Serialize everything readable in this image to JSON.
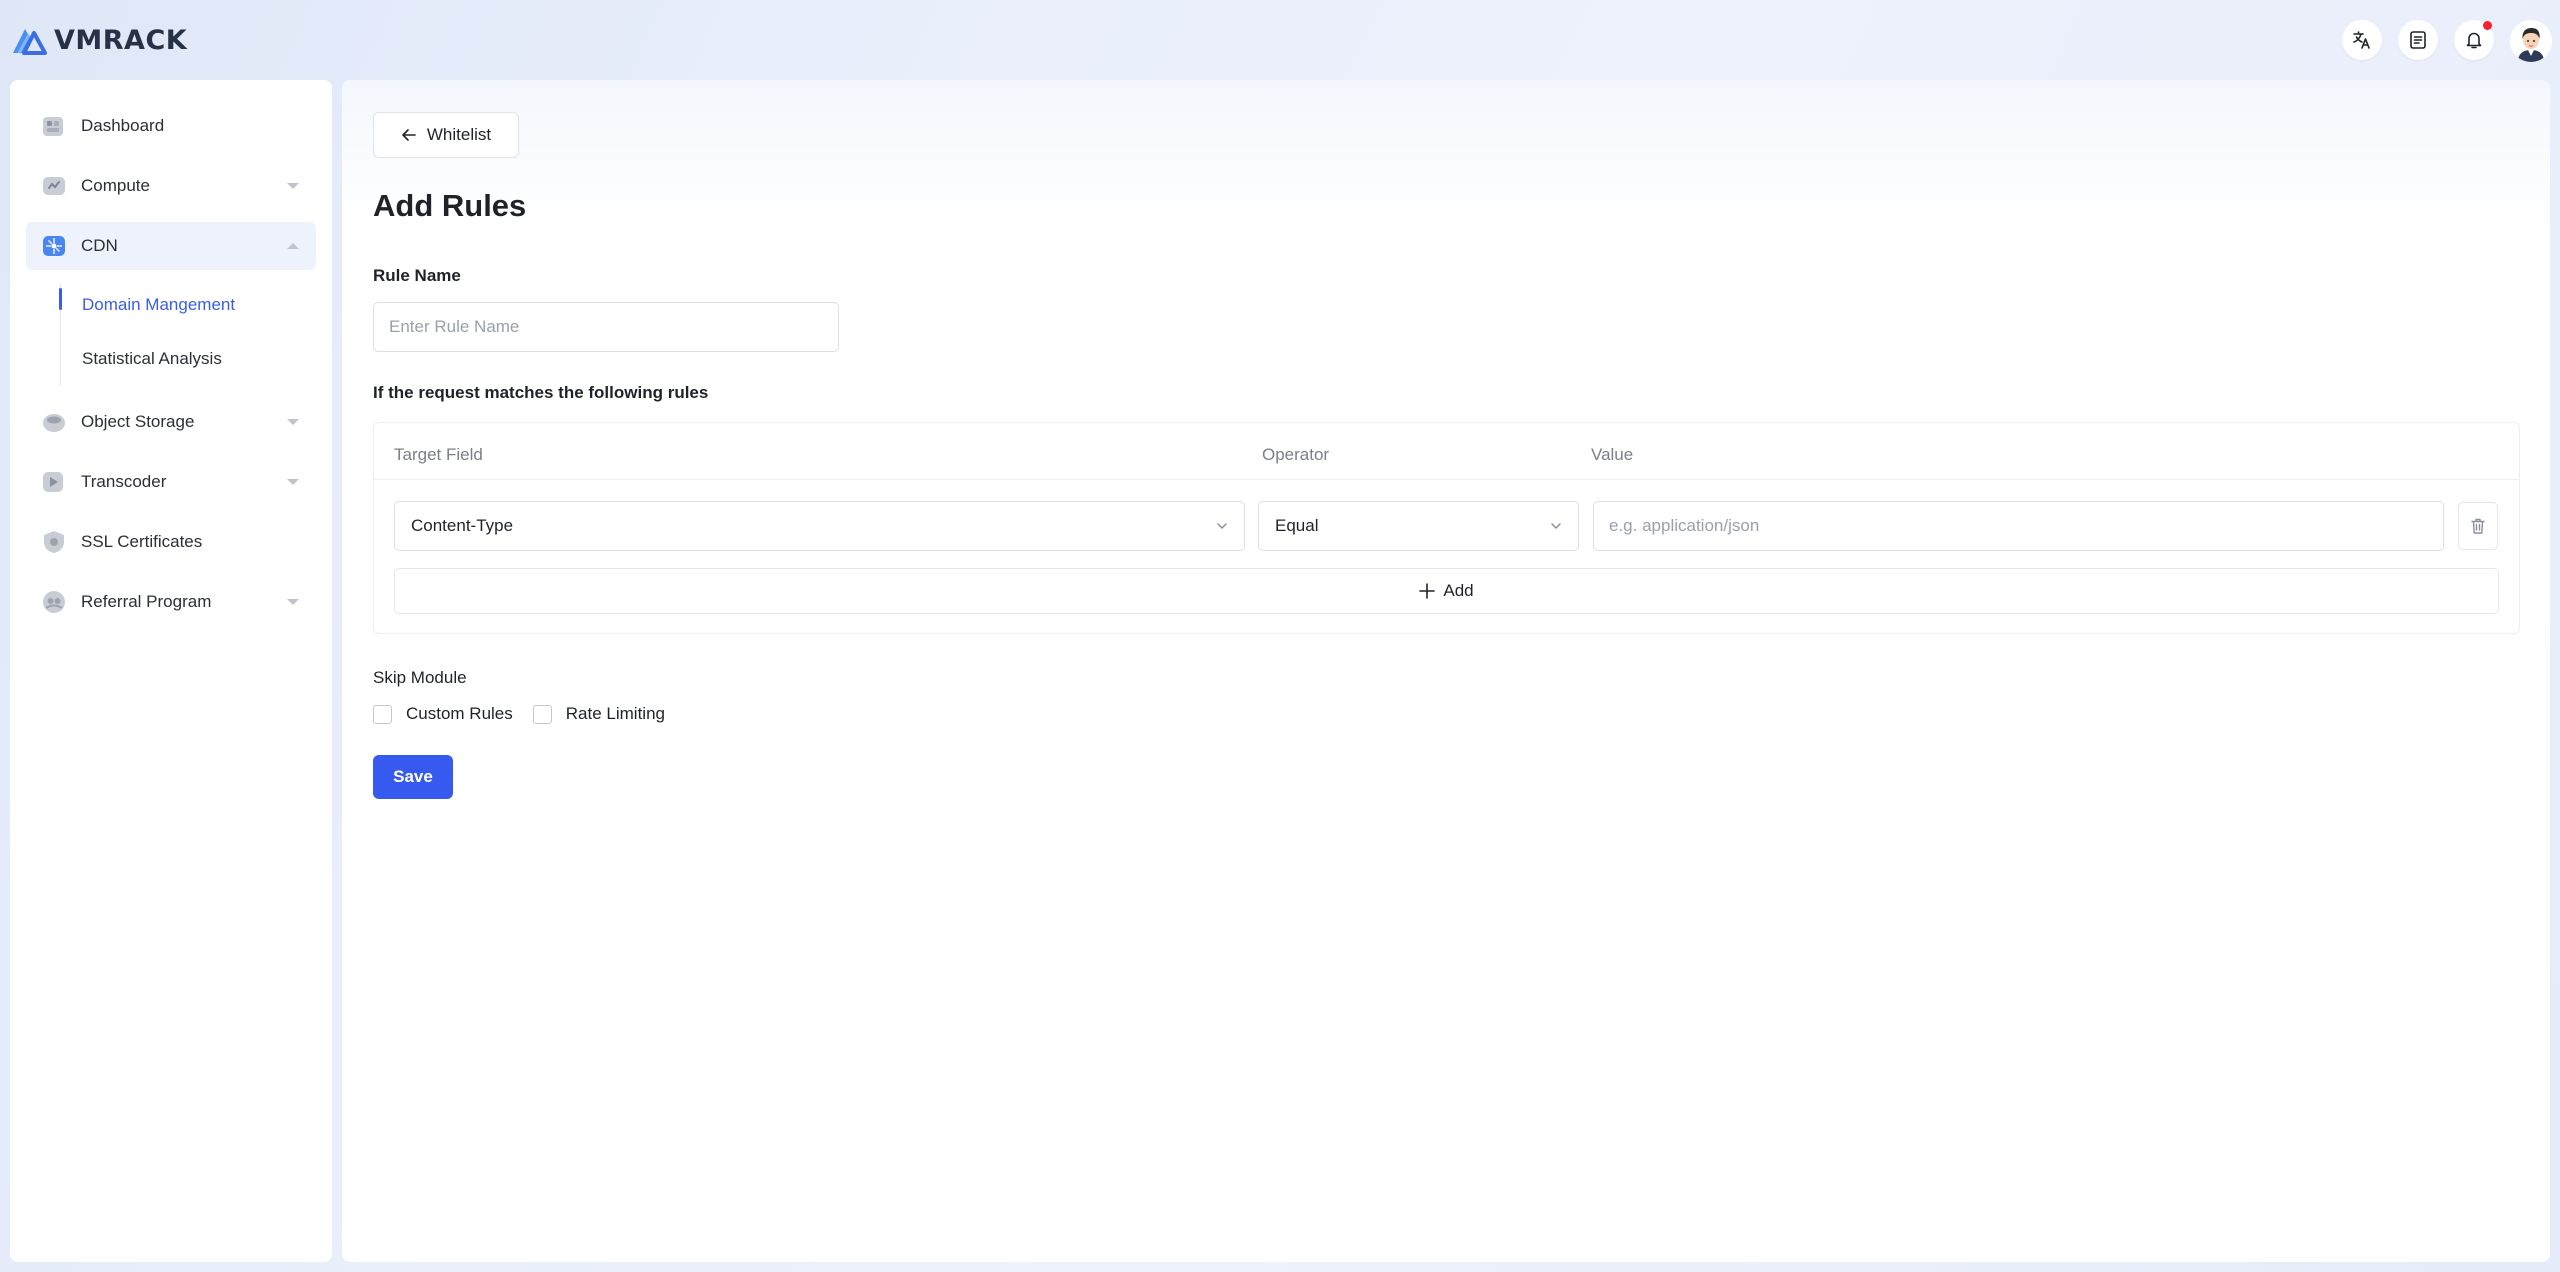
{
  "app": {
    "logo_text": "VMRACK"
  },
  "sidebar": {
    "items": [
      {
        "label": "Dashboard"
      },
      {
        "label": "Compute"
      },
      {
        "label": "CDN"
      },
      {
        "label": "Object Storage"
      },
      {
        "label": "Transcoder"
      },
      {
        "label": "SSL Certificates"
      },
      {
        "label": "Referral Program"
      }
    ],
    "cdn_sub": [
      {
        "label": "Domain Mangement"
      },
      {
        "label": "Statistical Analysis"
      }
    ]
  },
  "main": {
    "back_label": "Whitelist",
    "title": "Add Rules",
    "rule_name_label": "Rule Name",
    "rule_name_placeholder": "Enter Rule Name",
    "match_label": "If the request matches the following rules",
    "table": {
      "headers": [
        "Target Field",
        "Operator",
        "Value"
      ],
      "row": {
        "target_field": "Content-Type",
        "operator": "Equal",
        "value_placeholder": "e.g. application/json"
      },
      "add_label": "Add"
    },
    "skip_label": "Skip Module",
    "skip_options": [
      {
        "label": "Custom Rules",
        "checked": false
      },
      {
        "label": "Rate Limiting",
        "checked": false
      }
    ],
    "save_label": "Save"
  },
  "colors": {
    "primary": "#3659f0",
    "notify": "#f5222d"
  }
}
